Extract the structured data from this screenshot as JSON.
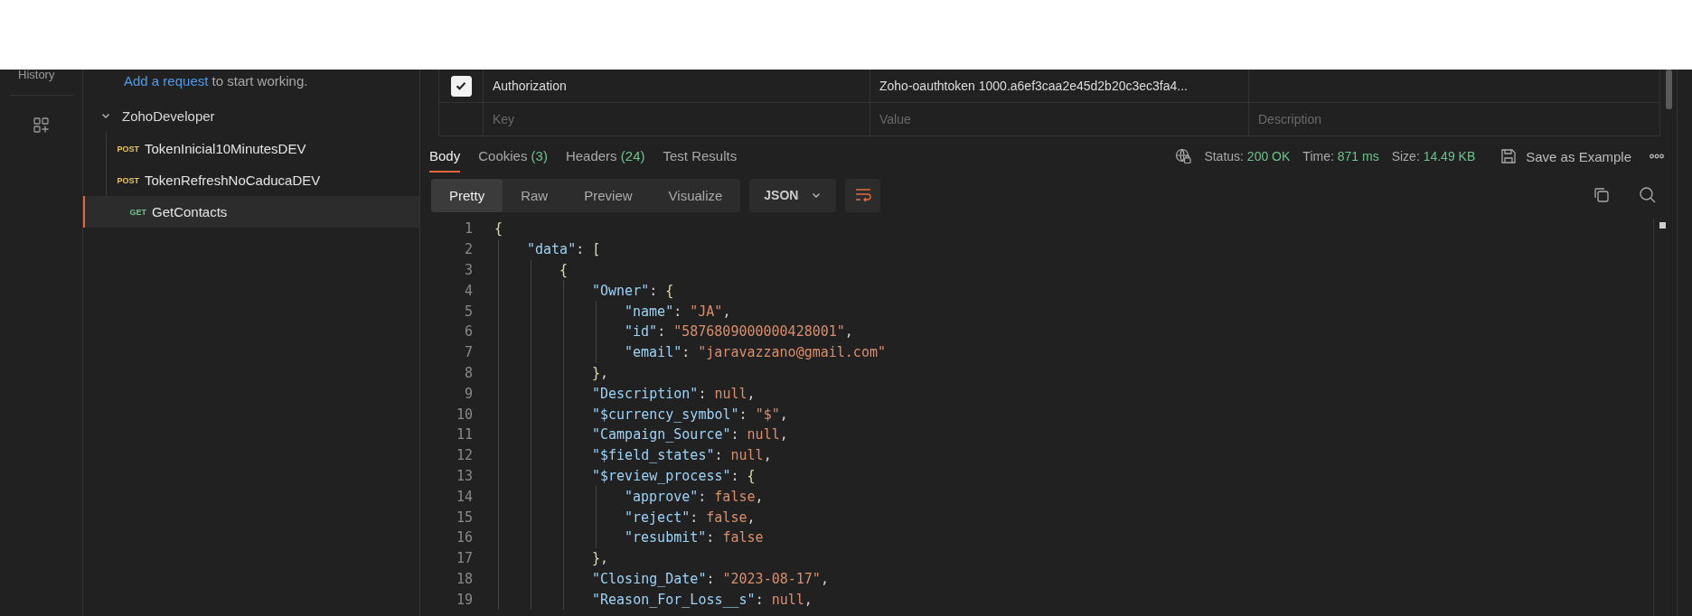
{
  "rail": {
    "history_label": "History"
  },
  "sidebar": {
    "hint_link": "Add a request",
    "hint_rest": " to start working.",
    "collection": {
      "name": "ZohoDeveloper",
      "expanded": true,
      "children": [
        {
          "method": "POST",
          "color": "#e8c75a",
          "name": "TokenInicial10MinutesDEV",
          "selected": false
        },
        {
          "method": "POST",
          "color": "#e8c75a",
          "name": "TokenRefreshNoCaducaDEV",
          "selected": false
        },
        {
          "method": "GET",
          "color": "#6cc48c",
          "name": "GetContacts",
          "selected": true
        }
      ]
    }
  },
  "headers_table": {
    "rows": [
      {
        "checked": true,
        "key": "Authorization",
        "value": "Zoho-oauthtoken 1000.a6ef3caa2e45d2b20c3ec3fa4..."
      }
    ],
    "placeholder_row": {
      "key": "Key",
      "value": "Value",
      "description": "Description"
    }
  },
  "response_tabs": [
    {
      "label": "Body",
      "selected": true
    },
    {
      "label": "Cookies",
      "count": "(3)",
      "selected": false
    },
    {
      "label": "Headers",
      "count": "(24)",
      "selected": false
    },
    {
      "label": "Test Results",
      "selected": false
    }
  ],
  "response_meta": [
    {
      "label": "Status:",
      "value": "200 OK"
    },
    {
      "label": "Time:",
      "value": "871 ms"
    },
    {
      "label": "Size:",
      "value": "14.49 KB"
    }
  ],
  "save_example": "Save as Example",
  "view_modes": [
    {
      "label": "Pretty",
      "selected": true
    },
    {
      "label": "Raw",
      "selected": false
    },
    {
      "label": "Preview",
      "selected": false
    },
    {
      "label": "Visualize",
      "selected": false
    }
  ],
  "format": "JSON",
  "code": [
    {
      "number": "1",
      "tokens": [
        {
          "kind": "brace",
          "text": "{"
        }
      ],
      "children": [
        {
          "number": "2",
          "tokens": [
            {
              "kind": "key",
              "text": "\"data\""
            },
            {
              "kind": "punct",
              "text": ": "
            },
            {
              "kind": "brace",
              "text": "["
            }
          ],
          "children": [
            {
              "number": "3",
              "tokens": [
                {
                  "kind": "brace",
                  "text": "{"
                }
              ],
              "children": [
                {
                  "number": "4",
                  "tokens": [
                    {
                      "kind": "key",
                      "text": "\"Owner\""
                    },
                    {
                      "kind": "punct",
                      "text": ": "
                    },
                    {
                      "kind": "brace",
                      "text": "{"
                    }
                  ],
                  "children": [
                    {
                      "number": "5",
                      "tokens": [
                        {
                          "kind": "key",
                          "text": "\"name\""
                        },
                        {
                          "kind": "punct",
                          "text": ": "
                        },
                        {
                          "kind": "string",
                          "text": "\"JA\""
                        },
                        {
                          "kind": "punct",
                          "text": ","
                        }
                      ]
                    },
                    {
                      "number": "6",
                      "tokens": [
                        {
                          "kind": "key",
                          "text": "\"id\""
                        },
                        {
                          "kind": "punct",
                          "text": ": "
                        },
                        {
                          "kind": "string",
                          "text": "\"5876809000000428001\""
                        },
                        {
                          "kind": "punct",
                          "text": ","
                        }
                      ]
                    },
                    {
                      "number": "7",
                      "tokens": [
                        {
                          "kind": "key",
                          "text": "\"email\""
                        },
                        {
                          "kind": "punct",
                          "text": ": "
                        },
                        {
                          "kind": "string",
                          "text": "\"jaravazzano@gmail.com\""
                        }
                      ]
                    }
                  ]
                },
                {
                  "number": "8",
                  "tokens": [
                    {
                      "kind": "brace",
                      "text": "}"
                    },
                    {
                      "kind": "punct",
                      "text": ","
                    }
                  ]
                },
                {
                  "number": "9",
                  "tokens": [
                    {
                      "kind": "key",
                      "text": "\"Description\""
                    },
                    {
                      "kind": "punct",
                      "text": ": "
                    },
                    {
                      "kind": "literal",
                      "text": "null"
                    },
                    {
                      "kind": "punct",
                      "text": ","
                    }
                  ]
                },
                {
                  "number": "10",
                  "tokens": [
                    {
                      "kind": "key",
                      "text": "\"$currency_symbol\""
                    },
                    {
                      "kind": "punct",
                      "text": ": "
                    },
                    {
                      "kind": "string",
                      "text": "\"$\""
                    },
                    {
                      "kind": "punct",
                      "text": ","
                    }
                  ]
                },
                {
                  "number": "11",
                  "tokens": [
                    {
                      "kind": "key",
                      "text": "\"Campaign_Source\""
                    },
                    {
                      "kind": "punct",
                      "text": ": "
                    },
                    {
                      "kind": "literal",
                      "text": "null"
                    },
                    {
                      "kind": "punct",
                      "text": ","
                    }
                  ]
                },
                {
                  "number": "12",
                  "tokens": [
                    {
                      "kind": "key",
                      "text": "\"$field_states\""
                    },
                    {
                      "kind": "punct",
                      "text": ": "
                    },
                    {
                      "kind": "literal",
                      "text": "null"
                    },
                    {
                      "kind": "punct",
                      "text": ","
                    }
                  ]
                },
                {
                  "number": "13",
                  "tokens": [
                    {
                      "kind": "key",
                      "text": "\"$review_process\""
                    },
                    {
                      "kind": "punct",
                      "text": ": "
                    },
                    {
                      "kind": "brace",
                      "text": "{"
                    }
                  ],
                  "children": [
                    {
                      "number": "14",
                      "tokens": [
                        {
                          "kind": "key",
                          "text": "\"approve\""
                        },
                        {
                          "kind": "punct",
                          "text": ": "
                        },
                        {
                          "kind": "literal",
                          "text": "false"
                        },
                        {
                          "kind": "punct",
                          "text": ","
                        }
                      ]
                    },
                    {
                      "number": "15",
                      "tokens": [
                        {
                          "kind": "key",
                          "text": "\"reject\""
                        },
                        {
                          "kind": "punct",
                          "text": ": "
                        },
                        {
                          "kind": "literal",
                          "text": "false"
                        },
                        {
                          "kind": "punct",
                          "text": ","
                        }
                      ]
                    },
                    {
                      "number": "16",
                      "tokens": [
                        {
                          "kind": "key",
                          "text": "\"resubmit\""
                        },
                        {
                          "kind": "punct",
                          "text": ": "
                        },
                        {
                          "kind": "literal",
                          "text": "false"
                        }
                      ]
                    }
                  ]
                },
                {
                  "number": "17",
                  "tokens": [
                    {
                      "kind": "brace",
                      "text": "}"
                    },
                    {
                      "kind": "punct",
                      "text": ","
                    }
                  ]
                },
                {
                  "number": "18",
                  "tokens": [
                    {
                      "kind": "key",
                      "text": "\"Closing_Date\""
                    },
                    {
                      "kind": "punct",
                      "text": ": "
                    },
                    {
                      "kind": "string",
                      "text": "\"2023-08-17\""
                    },
                    {
                      "kind": "punct",
                      "text": ","
                    }
                  ]
                },
                {
                  "number": "19",
                  "tokens": [
                    {
                      "kind": "key",
                      "text": "\"Reason_For_Loss__s\""
                    },
                    {
                      "kind": "punct",
                      "text": ": "
                    },
                    {
                      "kind": "literal",
                      "text": "null"
                    },
                    {
                      "kind": "punct",
                      "text": ","
                    }
                  ]
                }
              ]
            }
          ]
        }
      ]
    }
  ]
}
